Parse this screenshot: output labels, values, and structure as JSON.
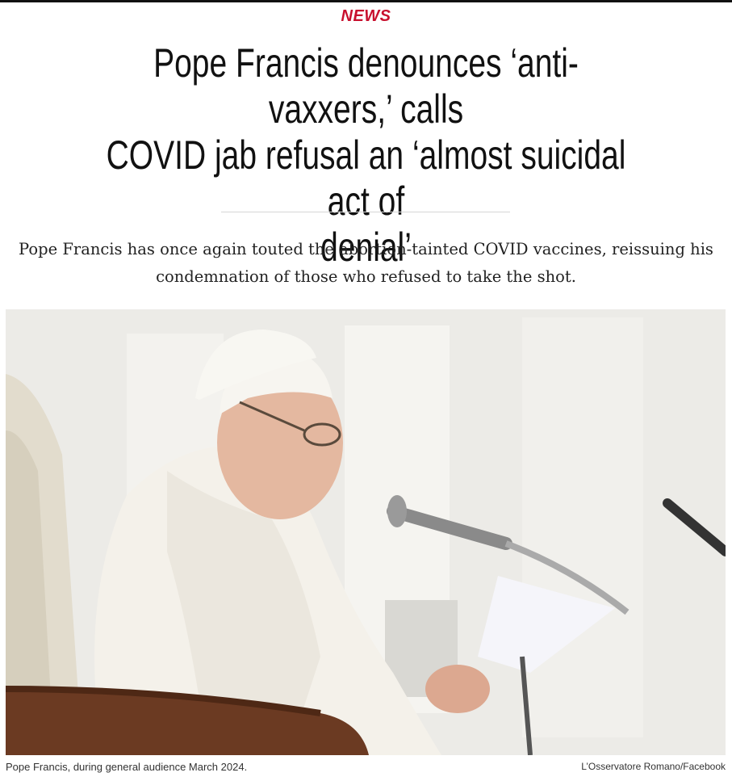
{
  "article": {
    "section": "NEWS",
    "headline_line1": "Pope Francis denounces ‘anti-vaxxers,’ calls",
    "headline_line2": "COVID jab refusal an ‘almost suicidal act of",
    "headline_line3": "denial’",
    "dek_line1": "Pope Francis has once again touted the abortion-tainted COVID vaccines, reissuing his",
    "dek_line2": "condemnation of those who refused to take the shot."
  },
  "photo": {
    "caption": "Pope Francis, during general audience March 2024.",
    "credit": "L’Osservatore Romano/Facebook"
  },
  "colors": {
    "section_tag": "#c8102e",
    "headline": "#111111",
    "divider": "#d6d6d6"
  }
}
